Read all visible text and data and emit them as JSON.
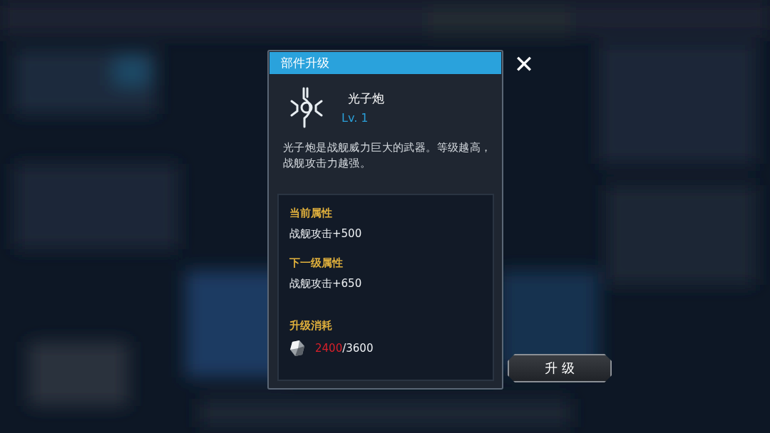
{
  "dialog": {
    "title": "部件升级",
    "part": {
      "name": "光子炮",
      "level": "Lv. 1",
      "description": "光子炮是战舰威力巨大的武器。等级越高，战舰攻击力越强。"
    },
    "attributes": [
      {
        "label": "当前属性",
        "value": "战舰攻击+500"
      },
      {
        "label": "下一级属性",
        "value": "战舰攻击+650"
      }
    ],
    "cost": {
      "label": "升级消耗",
      "owned": "2400",
      "separator": "/",
      "required": "3600",
      "insufficient": true
    }
  },
  "close_button": {
    "label": "✕"
  },
  "upgrade_button": {
    "label": "升 级"
  }
}
